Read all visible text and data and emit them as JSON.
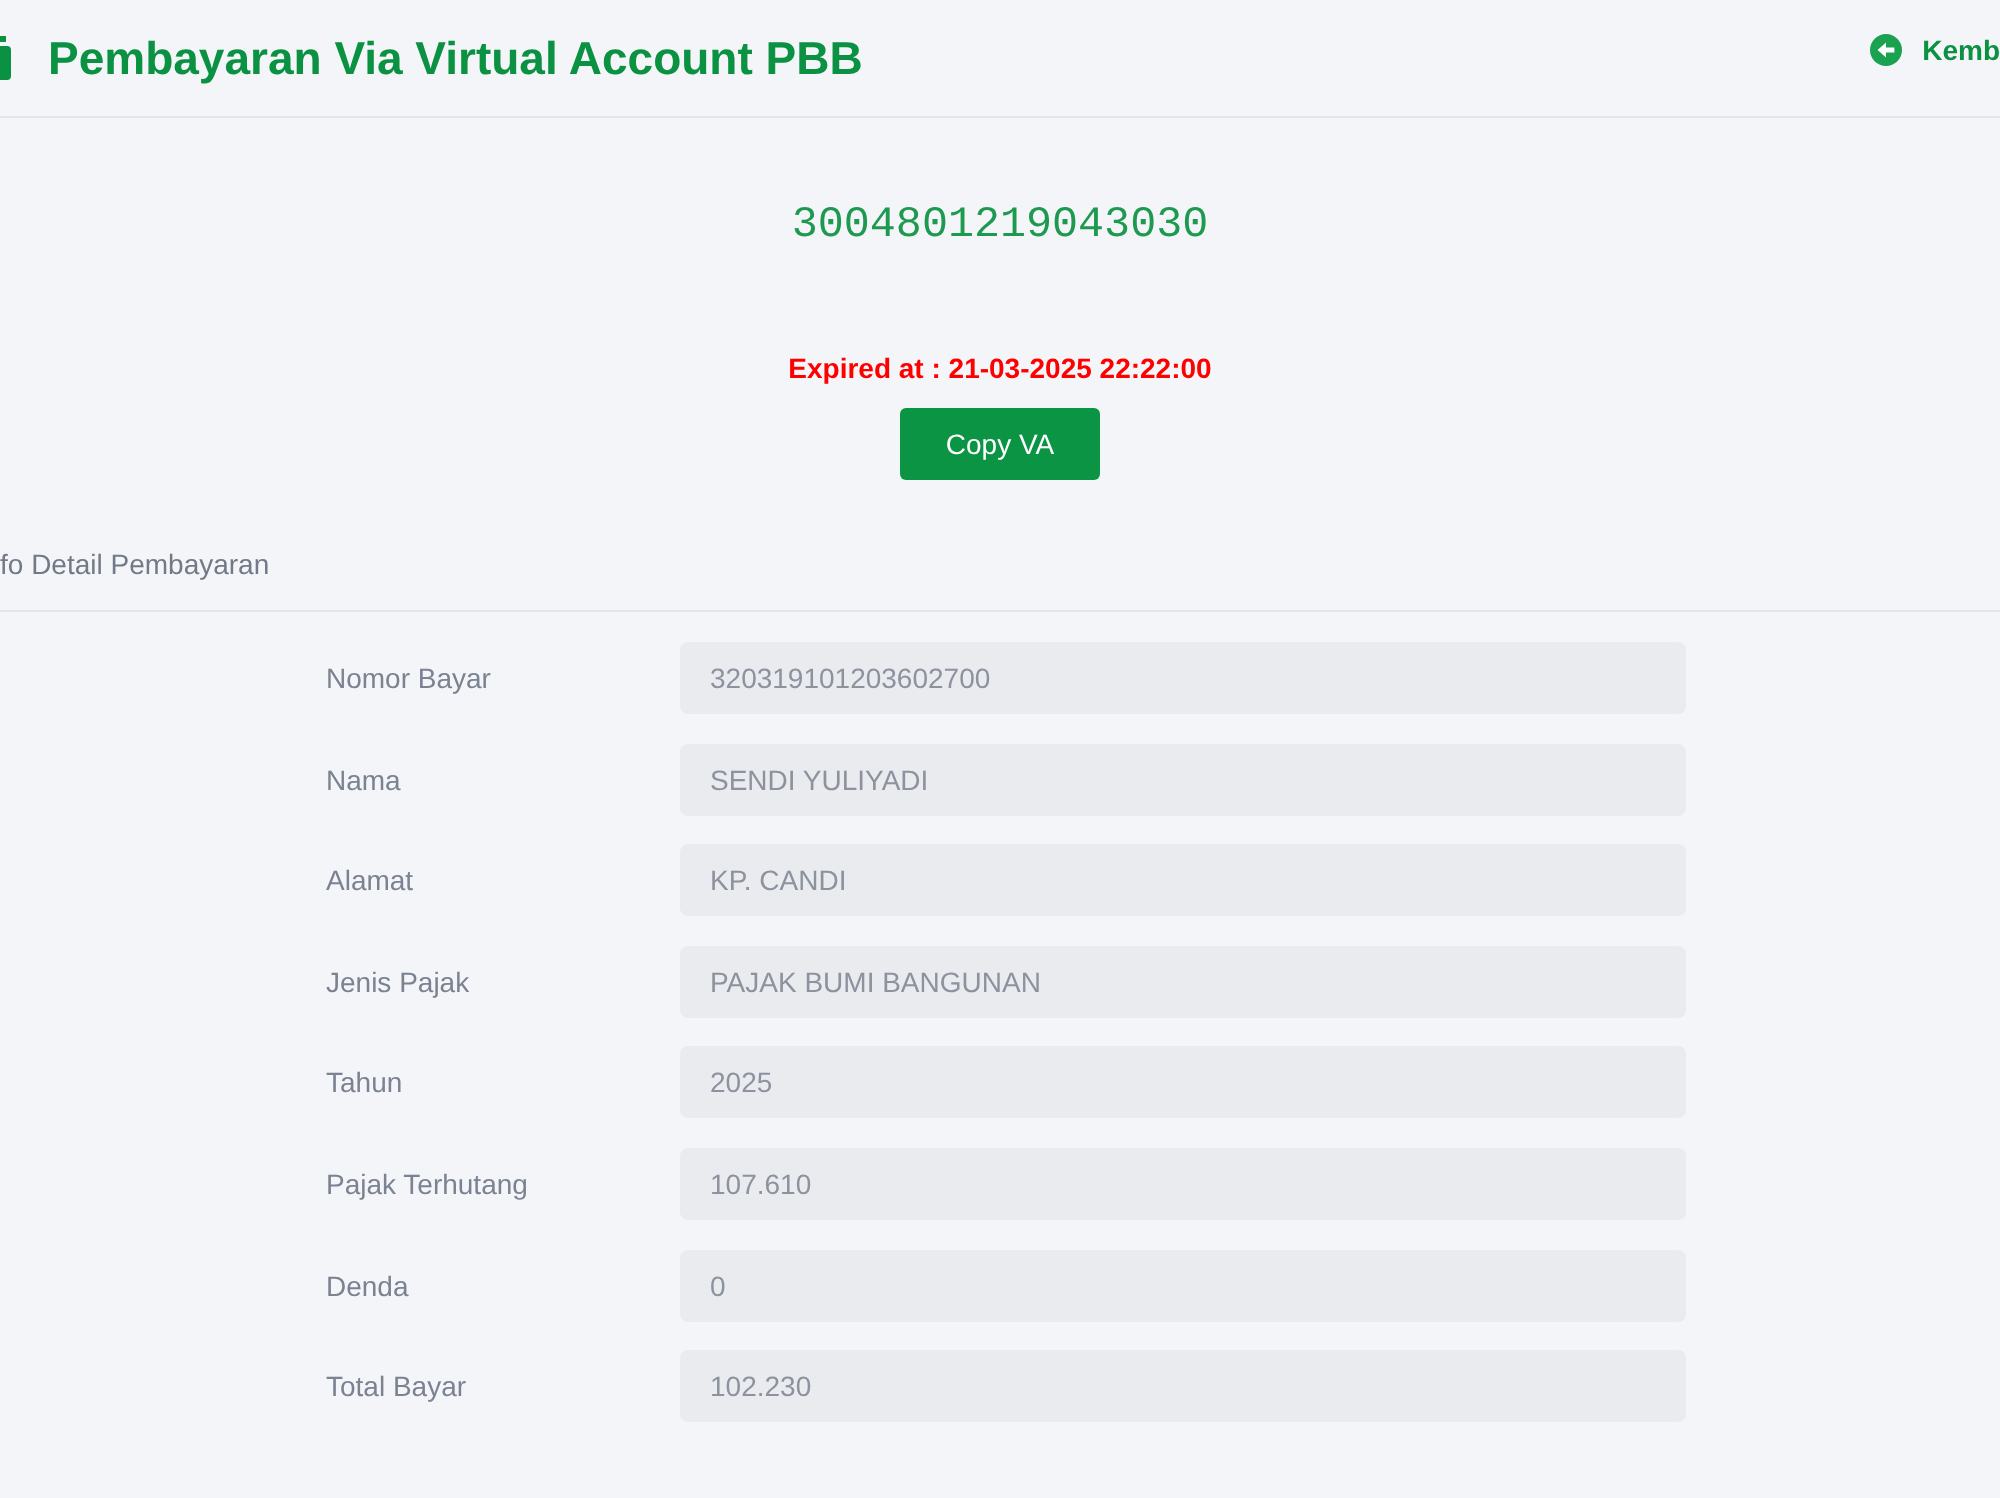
{
  "header": {
    "title": "Pembayaran Via Virtual Account PBB",
    "back_link": "Kemb"
  },
  "virtual_account": {
    "number": "3004801219043030",
    "expiry": "Expired at : 21-03-2025 22:22:00",
    "copy_button": "Copy VA"
  },
  "details": {
    "heading": "fo Detail Pembayaran",
    "fields": [
      {
        "label": "Nomor Bayar",
        "value": "320319101203602700",
        "disabled": true
      },
      {
        "label": "Nama",
        "value": "SENDI YULIYADI",
        "disabled": true
      },
      {
        "label": "Alamat",
        "value": "KP. CANDI",
        "disabled": true
      },
      {
        "label": "Jenis Pajak",
        "value": "PAJAK BUMI BANGUNAN",
        "disabled": true
      },
      {
        "label": "Tahun",
        "value": "2025",
        "disabled": true
      },
      {
        "label": "Pajak Terhutang",
        "value": "107.610",
        "disabled": true
      },
      {
        "label": "Denda",
        "value": "0",
        "disabled": true
      },
      {
        "label": "Total Bayar",
        "value": "102.230",
        "disabled": true
      }
    ]
  }
}
